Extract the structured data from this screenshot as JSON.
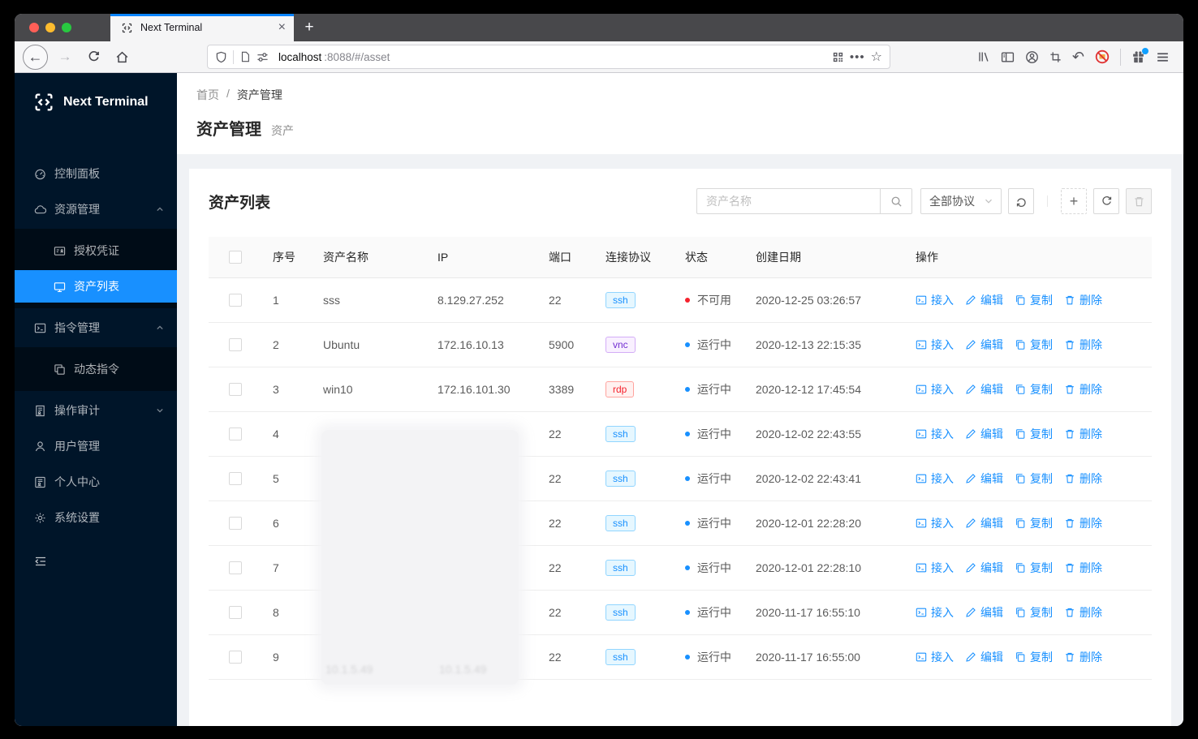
{
  "browser": {
    "tab_title": "Next Terminal",
    "close_glyph": "×",
    "new_tab_glyph": "+",
    "back_glyph": "←",
    "forward_glyph": "→",
    "dots_glyph": "•••",
    "star_glyph": "☆",
    "undo_glyph": "↶",
    "url_domain": "localhost",
    "url_rest": ":8088/#/asset"
  },
  "sidebar": {
    "logo_text": "Next Terminal",
    "menu": [
      {
        "id": "dashboard",
        "label": "控制面板",
        "icon": "dashboard-icon",
        "type": "item"
      },
      {
        "id": "resources",
        "label": "资源管理",
        "icon": "cloud-icon",
        "type": "group",
        "state": "expanded"
      },
      {
        "id": "credentials",
        "label": "授权凭证",
        "icon": "idcard-icon",
        "type": "subitem"
      },
      {
        "id": "asset-list",
        "label": "资产列表",
        "icon": "desktop-icon",
        "type": "subitem",
        "selected": true
      },
      {
        "id": "commands",
        "label": "指令管理",
        "icon": "code-icon",
        "type": "group",
        "state": "expanded"
      },
      {
        "id": "dynamic-commands",
        "label": "动态指令",
        "icon": "block-icon",
        "type": "subitem"
      },
      {
        "id": "audit",
        "label": "操作审计",
        "icon": "audit-icon",
        "type": "group",
        "state": "collapsed"
      },
      {
        "id": "users",
        "label": "用户管理",
        "icon": "user-icon",
        "type": "item"
      },
      {
        "id": "profile",
        "label": "个人中心",
        "icon": "profile-icon",
        "type": "item"
      },
      {
        "id": "settings",
        "label": "系统设置",
        "icon": "gear-icon",
        "type": "item"
      }
    ]
  },
  "page": {
    "breadcrumb": [
      "首页",
      "资产管理"
    ],
    "breadcrumb_separator": "/",
    "title": "资产管理",
    "subtitle": "资产"
  },
  "assets": {
    "card_title": "资产列表",
    "search_placeholder": "资产名称",
    "protocol_filter_value": "全部协议",
    "add_button_glyph": "+",
    "columns": [
      "序号",
      "资产名称",
      "IP",
      "端口",
      "连接协议",
      "状态",
      "创建日期",
      "操作"
    ],
    "action_labels": [
      "接入",
      "编辑",
      "复制",
      "删除"
    ],
    "action_ids": [
      "access",
      "edit",
      "copy",
      "delete"
    ],
    "redaction_faint_text": "10.1.5.49",
    "rows": [
      {
        "num": 1,
        "name": "sss",
        "ip": "8.129.27.252",
        "port": "22",
        "protocol": "ssh",
        "status": "不可用",
        "status_type": "error",
        "created": "2020-12-25 03:26:57",
        "redacted": false
      },
      {
        "num": 2,
        "name": "Ubuntu",
        "ip": "172.16.10.13",
        "port": "5900",
        "protocol": "vnc",
        "status": "运行中",
        "status_type": "running",
        "created": "2020-12-13 22:15:35",
        "redacted": false
      },
      {
        "num": 3,
        "name": "win10",
        "ip": "172.16.101.30",
        "port": "3389",
        "protocol": "rdp",
        "status": "运行中",
        "status_type": "running",
        "created": "2020-12-12 17:45:54",
        "redacted": false
      },
      {
        "num": 4,
        "name": "",
        "ip": "",
        "port": "22",
        "protocol": "ssh",
        "status": "运行中",
        "status_type": "running",
        "created": "2020-12-02 22:43:55",
        "redacted": true
      },
      {
        "num": 5,
        "name": "",
        "ip": "",
        "port": "22",
        "protocol": "ssh",
        "status": "运行中",
        "status_type": "running",
        "created": "2020-12-02 22:43:41",
        "redacted": true
      },
      {
        "num": 6,
        "name": "",
        "ip": "",
        "port": "22",
        "protocol": "ssh",
        "status": "运行中",
        "status_type": "running",
        "created": "2020-12-01 22:28:20",
        "redacted": true
      },
      {
        "num": 7,
        "name": "",
        "ip": "",
        "port": "22",
        "protocol": "ssh",
        "status": "运行中",
        "status_type": "running",
        "created": "2020-12-01 22:28:10",
        "redacted": true
      },
      {
        "num": 8,
        "name": "",
        "ip": "",
        "port": "22",
        "protocol": "ssh",
        "status": "运行中",
        "status_type": "running",
        "created": "2020-11-17 16:55:10",
        "redacted": true
      },
      {
        "num": 9,
        "name": "",
        "ip": "",
        "port": "22",
        "protocol": "ssh",
        "status": "运行中",
        "status_type": "running",
        "created": "2020-11-17 16:55:00",
        "redacted": true
      }
    ]
  },
  "colors": {
    "accent": "#1890ff",
    "sidebar_bg": "#001529",
    "submenu_bg": "#000c17",
    "selected_item_bg": "#1890ff",
    "page_bg": "#f0f2f5",
    "status_running": "#1890ff",
    "status_unavailable": "#f5222d",
    "tab_active_stripe": "#0a84ff",
    "tag_ssh": {
      "text": "#1890ff",
      "bg": "#e6f7ff",
      "border": "#91d5ff"
    },
    "tag_vnc": {
      "text": "#722ed1",
      "bg": "#f9f0ff",
      "border": "#d3adf7"
    },
    "tag_rdp": {
      "text": "#f5222d",
      "bg": "#fff1f0",
      "border": "#ffa39e"
    }
  }
}
